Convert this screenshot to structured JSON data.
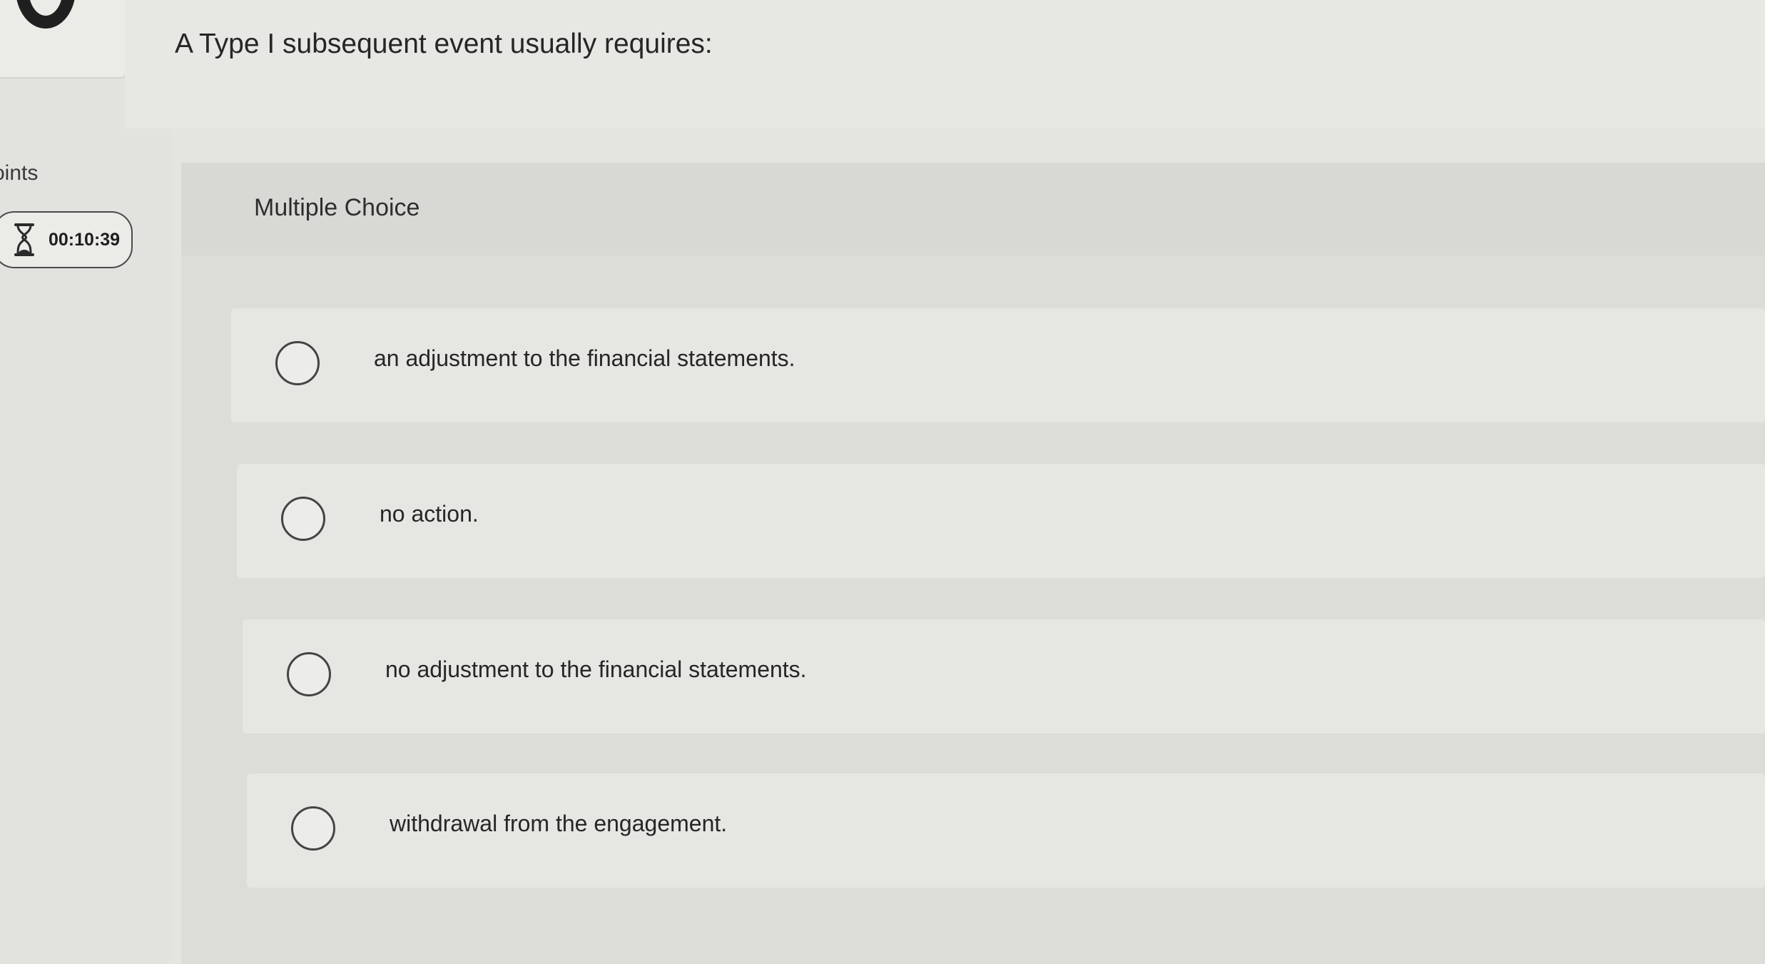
{
  "sidebar": {
    "points_label": "oints",
    "timer": "00:10:39"
  },
  "question": {
    "text": "A Type I subsequent event usually requires:",
    "type_label": "Multiple Choice"
  },
  "options": [
    {
      "label": "an adjustment to the financial statements."
    },
    {
      "label": "no action."
    },
    {
      "label": "no adjustment to the financial statements."
    },
    {
      "label": "withdrawal from the engagement."
    }
  ],
  "icons": {
    "logo": "logo-ring-icon",
    "timer": "hourglass-icon",
    "radio": "radio-unselected-icon"
  }
}
